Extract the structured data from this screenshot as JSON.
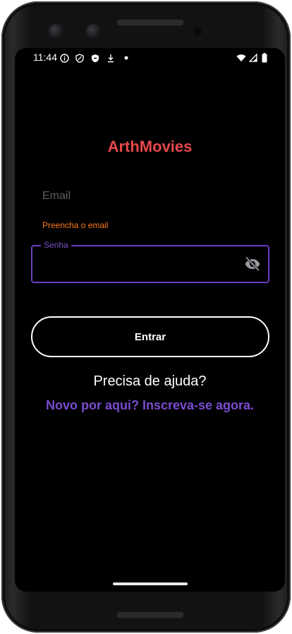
{
  "status_bar": {
    "time": "11:44",
    "icons": [
      "info-icon",
      "shield-icon",
      "badge-shield-icon",
      "download-arrow-icon",
      "dot-icon",
      "wifi-icon",
      "signal-icon",
      "battery-icon"
    ]
  },
  "app": {
    "title": "ArthMovies"
  },
  "form": {
    "email_placeholder": "Email",
    "email_error": "Preencha o email",
    "password_label": "Senha",
    "password_value": "",
    "login_label": "Entrar"
  },
  "links": {
    "help": "Precisa de ajuda?",
    "signup": "Novo por aqui? Inscreva-se agora."
  },
  "colors": {
    "brand": "#e5484a",
    "accent": "#6a3fbf",
    "error": "#ff7a1a",
    "background": "#000000"
  }
}
